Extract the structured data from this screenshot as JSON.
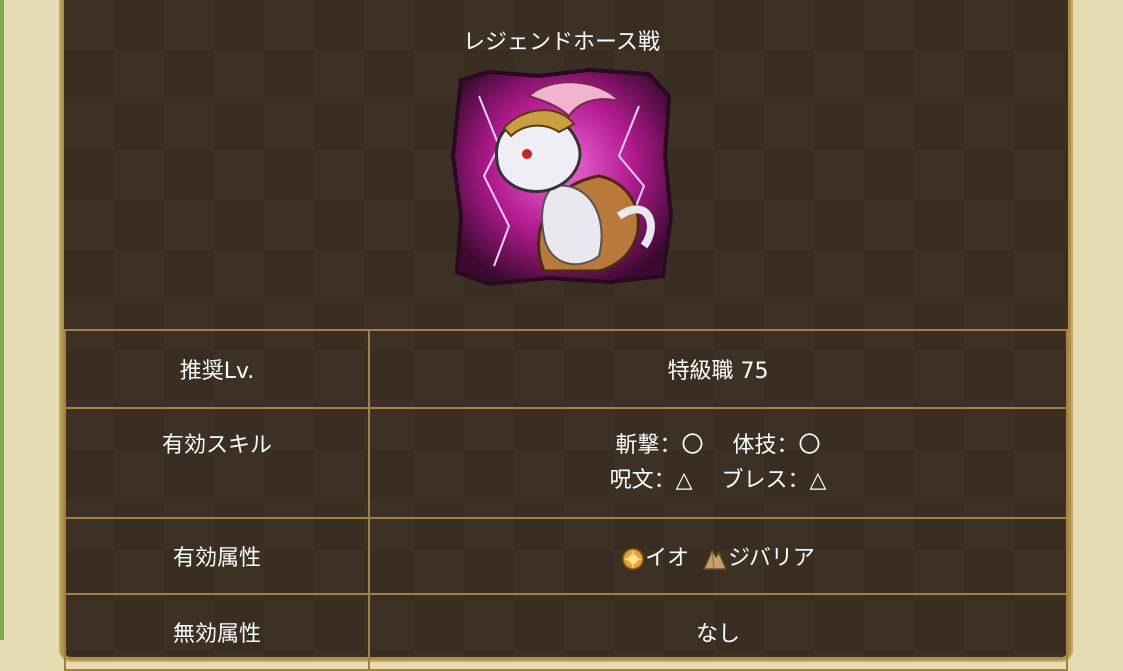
{
  "title": "レジェンドホース戦",
  "portrait": {
    "icon": "legend-horse-monster-icon"
  },
  "rows": {
    "level": {
      "label": "推奨Lv.",
      "value": "特級職 75"
    },
    "skills": {
      "label": "有効スキル",
      "line1": "斬撃：〇　 体技：〇",
      "line2": "呪文：△　 ブレス：△"
    },
    "effective": {
      "label": "有効属性",
      "items": [
        {
          "icon": "io-explosion-icon",
          "text": "イオ"
        },
        {
          "icon": "jibaria-earth-icon",
          "text": "ジバリア"
        }
      ]
    },
    "ineffective": {
      "label": "無効属性",
      "value": "なし"
    }
  },
  "colors": {
    "panel": "#3d3024",
    "border": "#a5813f",
    "text": "#ffffff",
    "page": "#e6dcb4"
  }
}
